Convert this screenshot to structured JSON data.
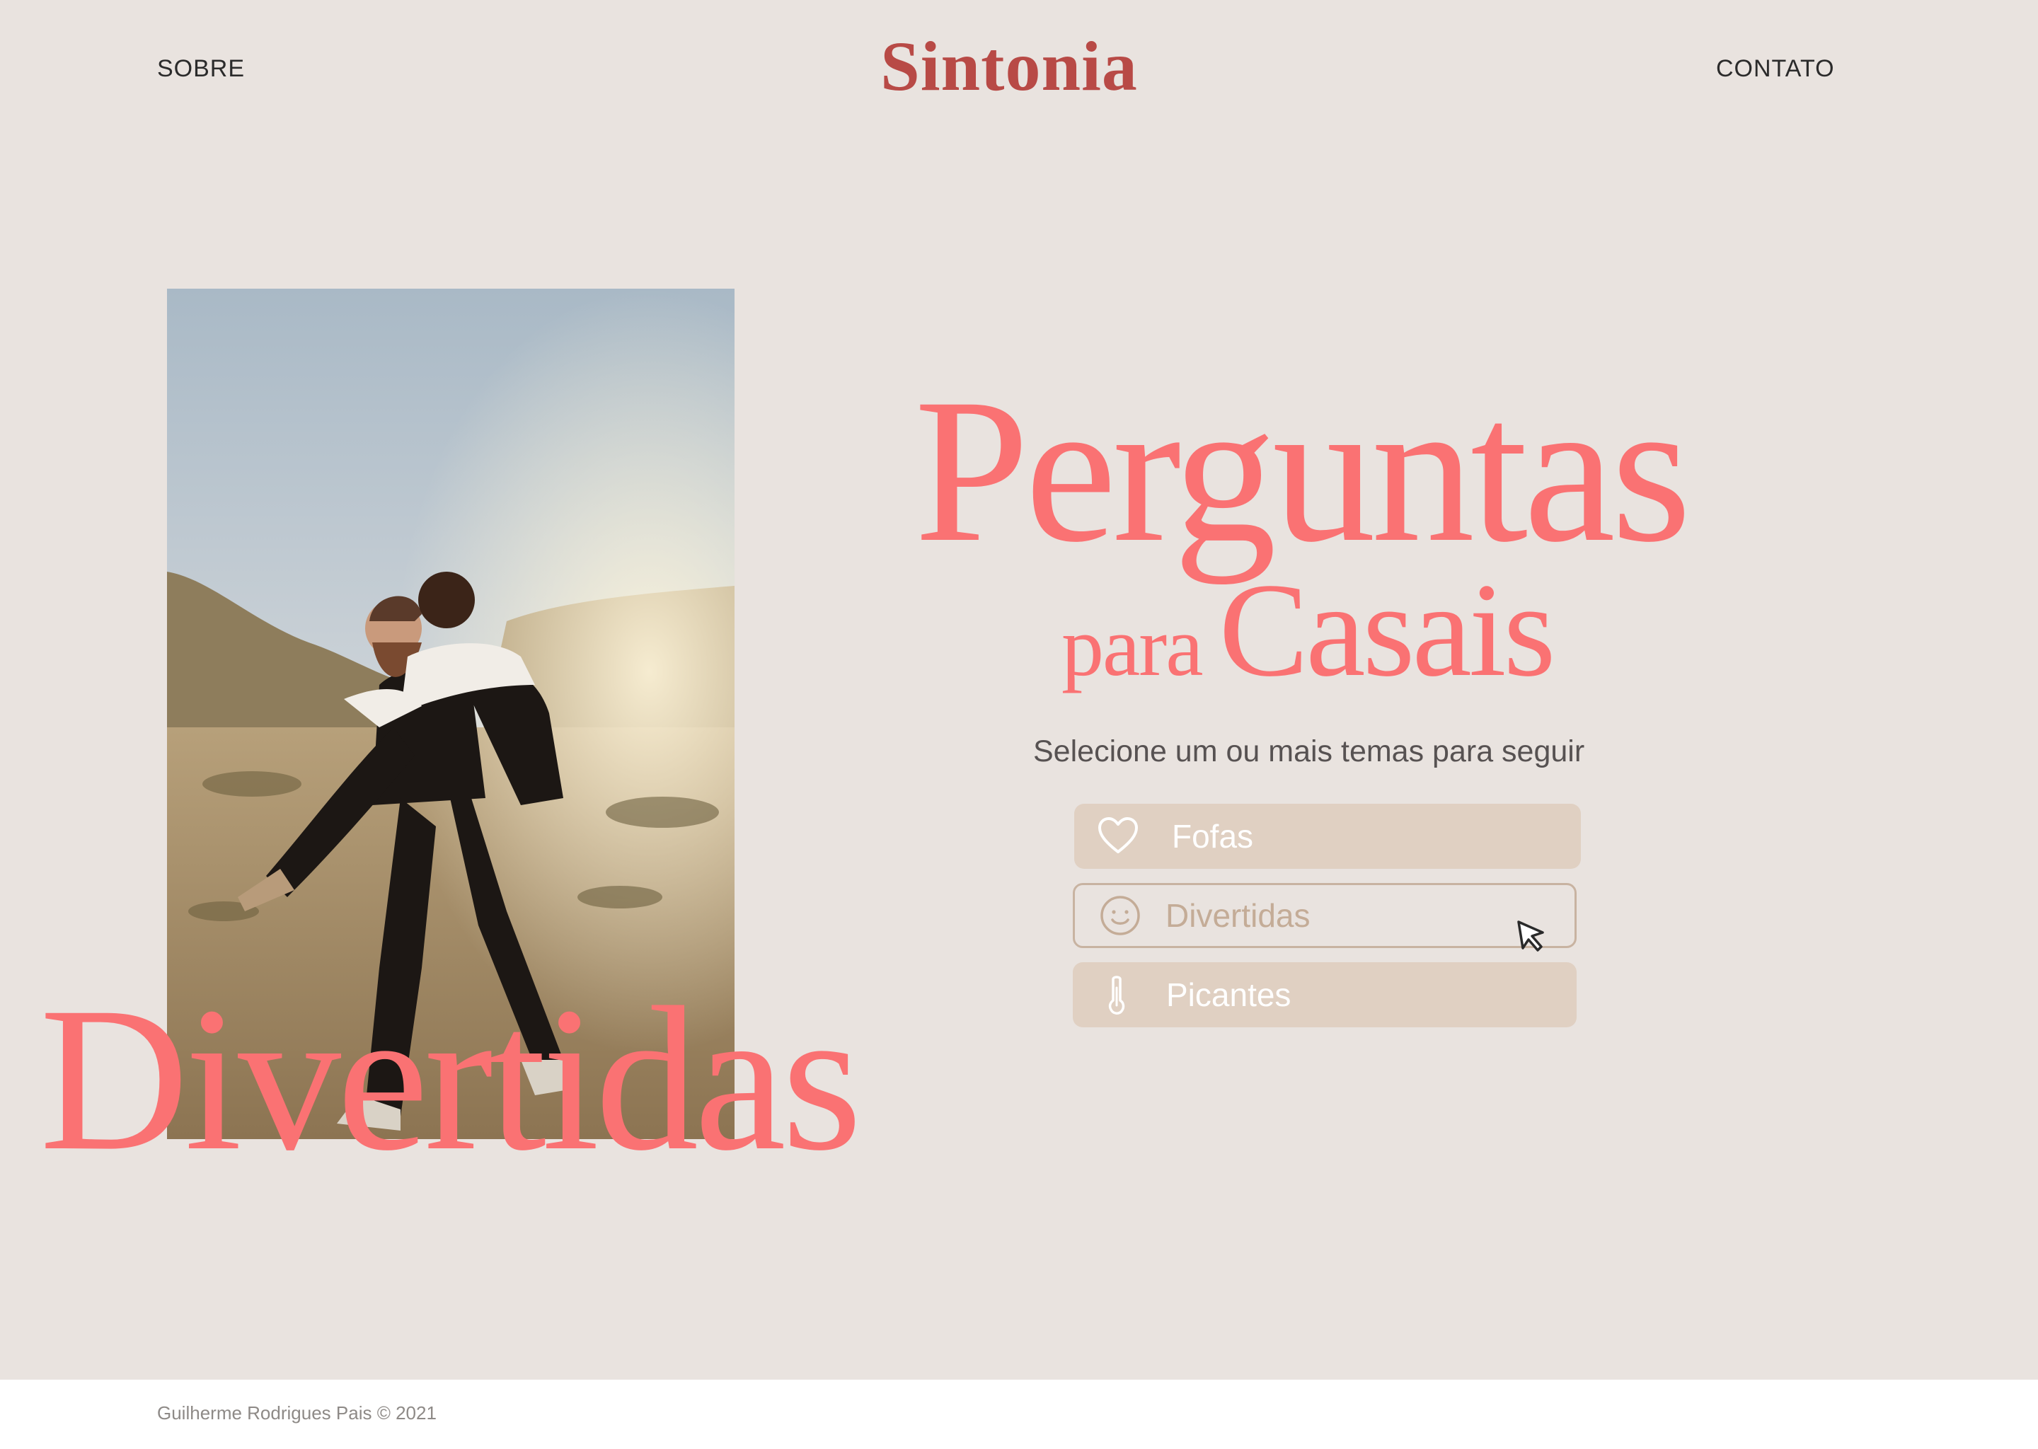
{
  "nav": {
    "left_link": "SOBRE",
    "brand": "Sintonia",
    "right_link": "CONTATO"
  },
  "hero": {
    "image_alt_icon": "couple-photo",
    "overlay_word": "Divertidas",
    "headline": "Perguntas",
    "subheadline_small": "para",
    "subheadline_big": "Casais",
    "instruction": "Selecione um ou mais temas para seguir",
    "themes": [
      {
        "label": "Fofas",
        "icon": "heart-icon",
        "state": "selected"
      },
      {
        "label": "Divertidas",
        "icon": "smiley-icon",
        "state": "hover"
      },
      {
        "label": "Picantes",
        "icon": "thermometer-icon",
        "state": "selected"
      }
    ]
  },
  "footer": {
    "copyright": "Guilherme Rodrigues Pais © 2021"
  },
  "colors": {
    "background": "#e9e3df",
    "accent": "#fa7273",
    "brand": "#b84a46",
    "chip": "#e0d0c2",
    "chip_border": "#c8b3a1"
  }
}
